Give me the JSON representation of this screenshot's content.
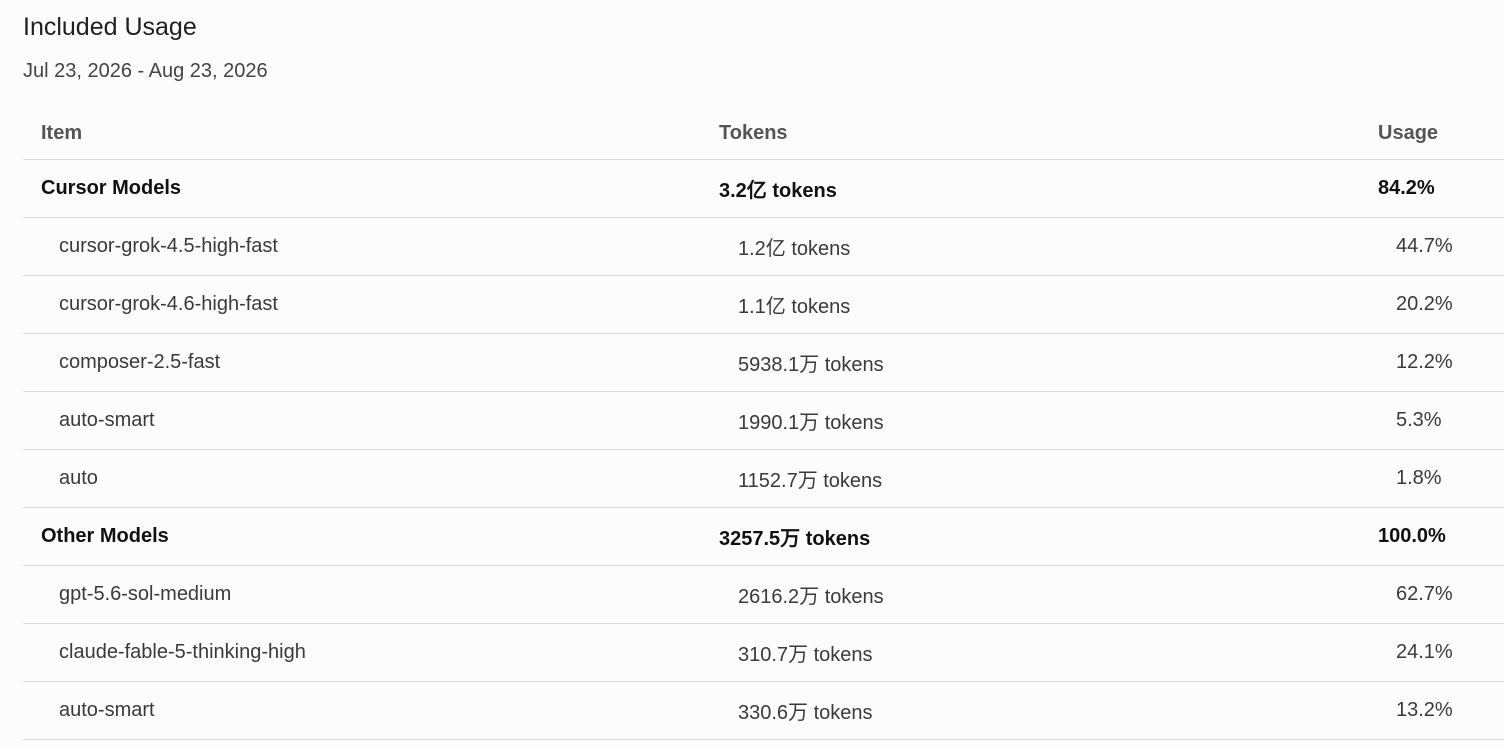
{
  "page": {
    "title": "Included Usage",
    "date_range": "Jul 23, 2026 - Aug 23, 2026"
  },
  "table": {
    "headers": {
      "item": "Item",
      "tokens": "Tokens",
      "usage": "Usage"
    },
    "groups": [
      {
        "name": "Cursor Models",
        "tokens": "3.2亿 tokens",
        "usage": "84.2%",
        "rows": [
          {
            "item": "cursor-grok-4.5-high-fast",
            "tokens": "1.2亿 tokens",
            "usage": "44.7%"
          },
          {
            "item": "cursor-grok-4.6-high-fast",
            "tokens": "1.1亿 tokens",
            "usage": "20.2%"
          },
          {
            "item": "composer-2.5-fast",
            "tokens": "5938.1万 tokens",
            "usage": "12.2%"
          },
          {
            "item": "auto-smart",
            "tokens": "1990.1万 tokens",
            "usage": "5.3%"
          },
          {
            "item": "auto",
            "tokens": "1152.7万 tokens",
            "usage": "1.8%"
          }
        ]
      },
      {
        "name": "Other Models",
        "tokens": "3257.5万 tokens",
        "usage": "100.0%",
        "rows": [
          {
            "item": "gpt-5.6-sol-medium",
            "tokens": "2616.2万 tokens",
            "usage": "62.7%"
          },
          {
            "item": "claude-fable-5-thinking-high",
            "tokens": "310.7万 tokens",
            "usage": "24.1%"
          },
          {
            "item": "auto-smart",
            "tokens": "330.6万 tokens",
            "usage": "13.2%"
          }
        ]
      }
    ]
  }
}
